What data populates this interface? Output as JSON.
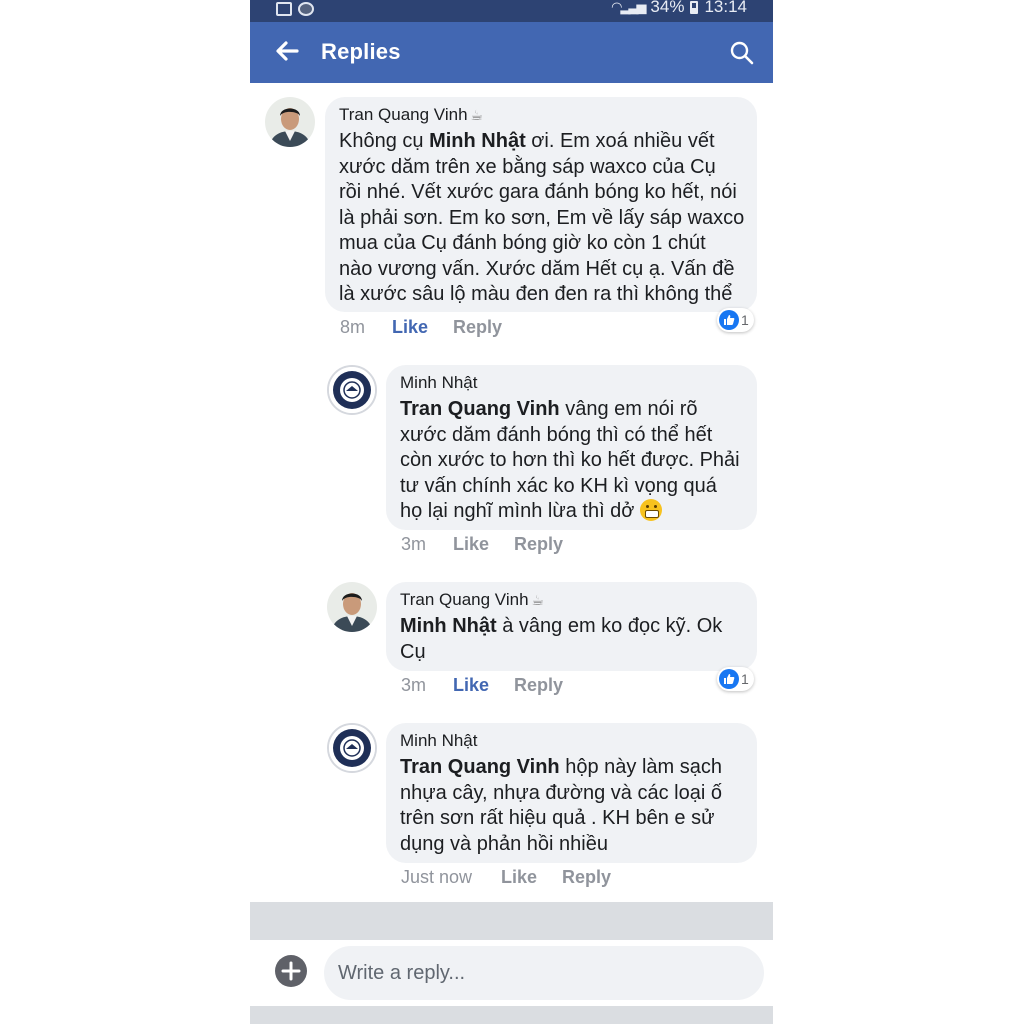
{
  "status_bar": {
    "battery": "34%",
    "time": "13:14"
  },
  "header": {
    "title": "Replies"
  },
  "comments": [
    {
      "author": "Tran Quang Vinh",
      "mention": "",
      "text_lines": [
        "Không cụ ",
        "Minh Nhật",
        " ơi. Em xoá nhiều vết",
        "xước dăm trên xe bằng sáp waxco của Cụ",
        "rồi nhé. Vết xước gara đánh bóng ko hết, nói",
        "là phải sơn. Em ko sơn, Em về lấy sáp waxco",
        "mua của Cụ đánh bóng giờ ko còn 1 chút",
        "nào vương vấn. Xước dăm Hết cụ ạ. Vấn đề",
        "là xước sâu lộ màu đen đen ra thì không thể"
      ],
      "time": "8m",
      "like": "Like",
      "reply": "Reply",
      "reactions": "1"
    },
    {
      "author": "Minh Nhật",
      "mention": "Tran Quang Vinh",
      "text_lines": [
        " vâng em nói rõ",
        "xước dăm đánh bóng thì có thể hết",
        "còn xước to hơn thì ko hết được. Phải",
        "tư vấn chính xác ko KH kì vọng quá",
        "họ lại nghĩ mình lừa thì dở"
      ],
      "time": "3m",
      "like": "Like",
      "reply": "Reply"
    },
    {
      "author": "Tran Quang Vinh",
      "mention": "Minh Nhật",
      "text_lines": [
        " à vâng em ko đọc kỹ. Ok",
        "Cụ"
      ],
      "time": "3m",
      "like": "Like",
      "reply": "Reply",
      "reactions": "1"
    },
    {
      "author": "Minh Nhật",
      "mention": "Tran Quang Vinh",
      "text_lines": [
        " hộp này làm sạch",
        "nhựa cây, nhựa đường và các loại ố",
        "trên sơn rất hiệu quả . KH bên e sử",
        "dụng và phản hồi nhiều"
      ],
      "time": "Just now",
      "like": "Like",
      "reply": "Reply"
    }
  ],
  "composer": {
    "placeholder": "Write a reply..."
  },
  "colors": {
    "header": "#4267b2",
    "status_bar": "#2d4373",
    "bubble": "#f0f2f5",
    "like_active": "#4267b2",
    "meta": "#90949c"
  },
  "icons": {
    "back": "back-arrow-icon",
    "search": "search-icon",
    "add": "plus-icon",
    "like_reaction": "thumbs-up-icon",
    "emoji": "grinning-emoji-icon"
  }
}
